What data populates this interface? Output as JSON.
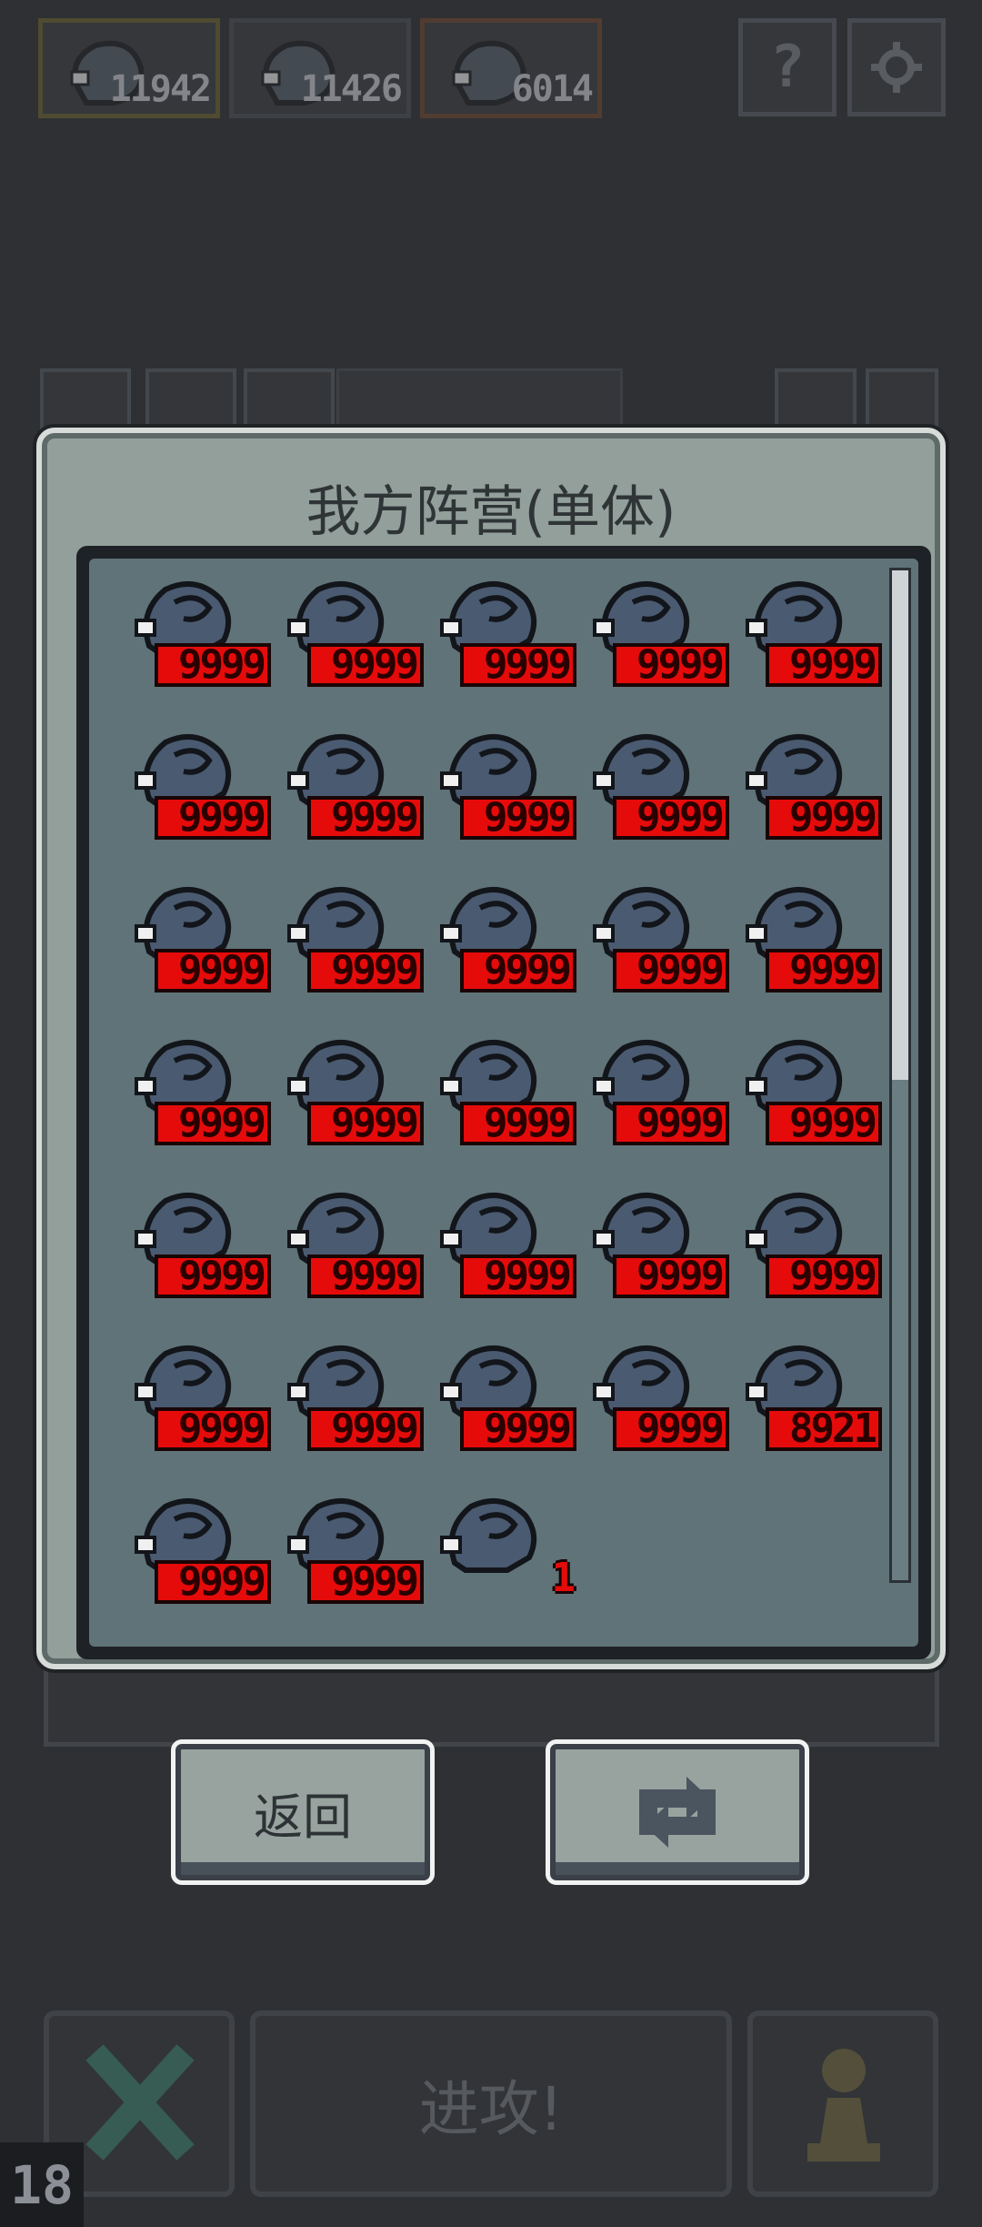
{
  "resources": [
    {
      "icon": "fish-unit-icon",
      "count": "11942",
      "accent": "#6a6230"
    },
    {
      "icon": "fish-unit-icon",
      "count": "11426",
      "accent": "#4a4e55"
    },
    {
      "icon": "fish-unit-icon",
      "count": "6014",
      "accent": "#6e4630"
    }
  ],
  "top_buttons": {
    "help": "?",
    "settings": "gear-icon"
  },
  "dialog": {
    "title": "我方阵营(单体)",
    "units": [
      "9999",
      "9999",
      "9999",
      "9999",
      "9999",
      "9999",
      "9999",
      "9999",
      "9999",
      "9999",
      "9999",
      "9999",
      "9999",
      "9999",
      "9999",
      "9999",
      "9999",
      "9999",
      "9999",
      "9999",
      "9999",
      "9999",
      "9999",
      "9999",
      "9999",
      "9999",
      "9999",
      "9999",
      "9999",
      "8921",
      "9999",
      "9999",
      "1"
    ]
  },
  "buttons": {
    "back": "返回",
    "refresh": "refresh-icon"
  },
  "bottom": {
    "attack": "进攻!",
    "level": "18"
  },
  "colors": {
    "hp_bar": "#e60b0b",
    "panel": "#929f9a",
    "list_bg": "#5f7378"
  }
}
